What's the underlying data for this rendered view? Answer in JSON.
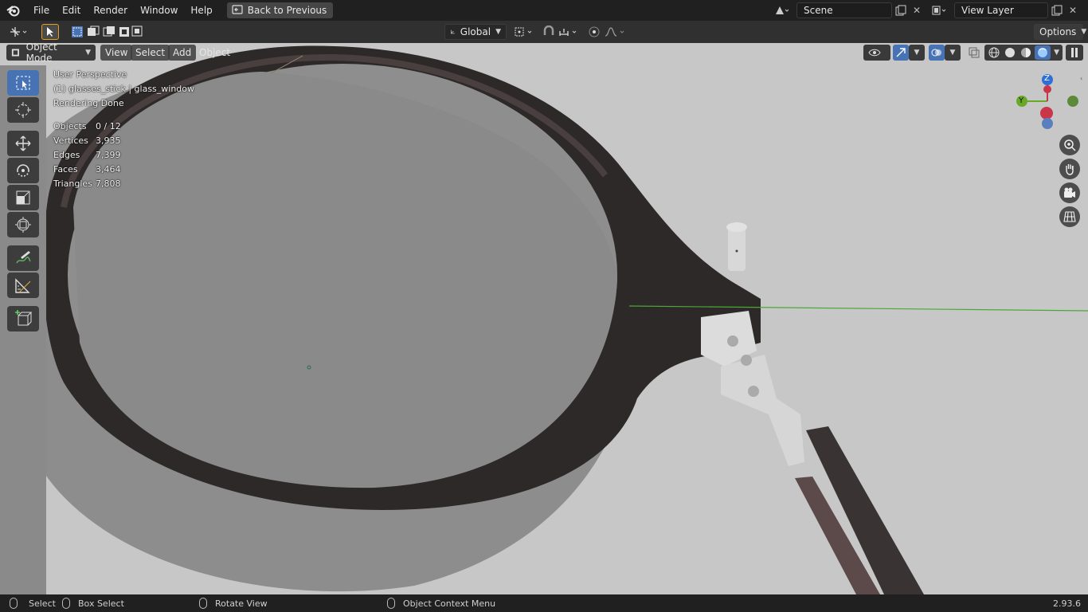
{
  "menubar": {
    "items": [
      "File",
      "Edit",
      "Render",
      "Window",
      "Help"
    ],
    "back_button": "Back to Previous",
    "scene_name": "Scene",
    "view_layer": "View Layer"
  },
  "header": {
    "transform_orientation": "Global",
    "options_label": "Options"
  },
  "viewport": {
    "mode": "Object Mode",
    "menus": [
      "View",
      "Select",
      "Add",
      "Object"
    ],
    "perspective": "User Perspective",
    "active_object": "(1) glasses_stick | glass_window",
    "render_status": "Rendering Done",
    "stats": [
      {
        "label": "Objects",
        "value": "0 / 12"
      },
      {
        "label": "Vertices",
        "value": "3,935"
      },
      {
        "label": "Edges",
        "value": "7,399"
      },
      {
        "label": "Faces",
        "value": "3,464"
      },
      {
        "label": "Triangles",
        "value": "7,808"
      }
    ],
    "gizmo": {
      "z": "Z",
      "y": "Y"
    }
  },
  "statusbar": {
    "select": "Select",
    "box_select": "Box Select",
    "rotate_view": "Rotate View",
    "context_menu": "Object Context Menu",
    "version": "2.93.6"
  },
  "colors": {
    "accent": "#4772b3",
    "topbar": "#202020",
    "viewport_bg": "#c6c6c6"
  }
}
